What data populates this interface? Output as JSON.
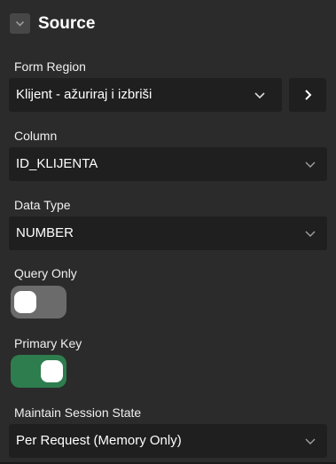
{
  "section": {
    "title": "Source"
  },
  "fields": {
    "form_region": {
      "label": "Form Region",
      "value": "Klijent - ažuriraj i izbriši"
    },
    "column": {
      "label": "Column",
      "value": "ID_KLIJENTA"
    },
    "data_type": {
      "label": "Data Type",
      "value": "NUMBER"
    },
    "query_only": {
      "label": "Query Only",
      "checked": false
    },
    "primary_key": {
      "label": "Primary Key",
      "checked": true
    },
    "maintain_session_state": {
      "label": "Maintain Session State",
      "value": "Per Request (Memory Only)"
    }
  },
  "colors": {
    "background": "#2b2b2b",
    "field_background": "#1f1f1f",
    "toggle_on": "#2e7d4f",
    "toggle_off": "#6b6b6b"
  },
  "icons": {
    "collapse": "chevron-down-icon",
    "navigate": "chevron-right-icon",
    "dropdown": "chevron-down-icon"
  }
}
